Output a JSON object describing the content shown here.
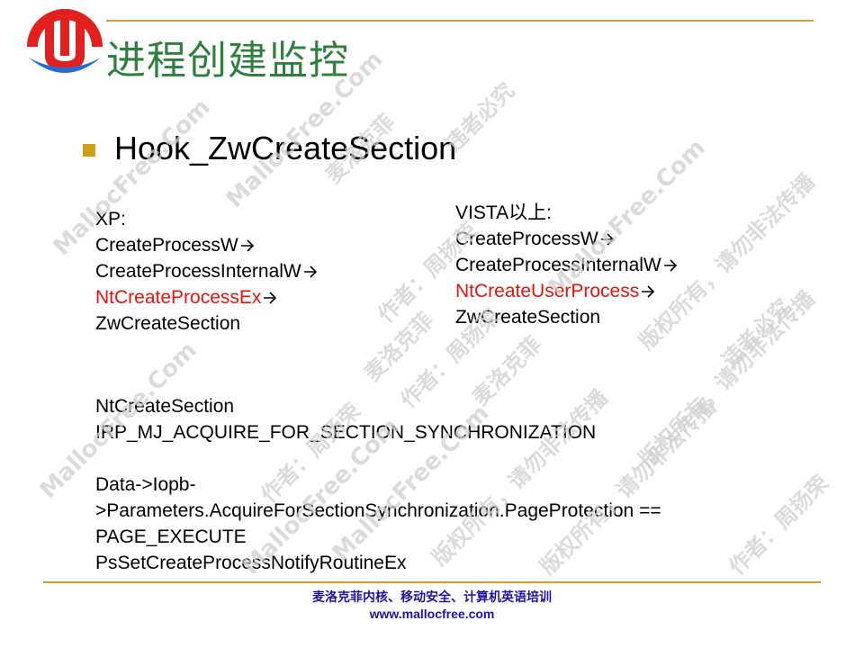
{
  "slide": {
    "title": "进程创建监控",
    "heading": "Hook_ZwCreateSection",
    "xp_block": [
      "XP:",
      "CreateProcessW",
      "CreateProcessInternalW",
      "NtCreateProcessEx",
      "ZwCreateSection"
    ],
    "vista_block": [
      "VISTA以上:",
      "CreateProcessW",
      "CreateProcessInternalW",
      "NtCreateUserProcess",
      "ZwCreateSection"
    ],
    "lower_block": [
      "NtCreateSection",
      "IRP_MJ_ACQUIRE_FOR_SECTION_SYNCHRONIZATION",
      "",
      "Data->Iopb-",
      ">Parameters.AcquireForSectionSynchronization.PageProtection ==",
      "PAGE_EXECUTE",
      "PsSetCreateProcessNotifyRoutineEx"
    ]
  },
  "footer": {
    "line1": "麦洛克菲内核、移动安全、计算机英语培训",
    "line2": "www.mallocfree.com"
  },
  "watermark": {
    "site": "MallocFree.Com",
    "company": "麦洛克菲",
    "author": "作者：周扬荣",
    "rights": "版权所有，请勿非法传播",
    "warning": "违者必究"
  },
  "colors": {
    "title": "#2f7f3f",
    "accent_line": "#c8a63c",
    "bullet": "#c9a21a",
    "highlight": "#e8120c",
    "footer": "#1f14a6",
    "logo_red": "#e41f1f",
    "logo_blue": "#1f6fd6"
  },
  "icons": {
    "logo": "mallocfree-logo",
    "arrow": "right-arrow-icon",
    "bullet": "square-bullet-icon"
  }
}
